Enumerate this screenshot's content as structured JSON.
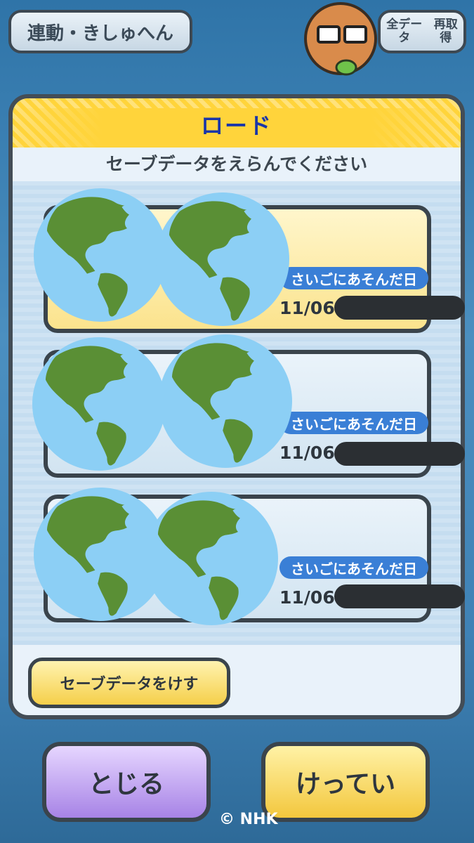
{
  "top": {
    "link_button": "連動・きしゅへん",
    "refetch_line1": "全データ",
    "refetch_line2": "再取得"
  },
  "dialog": {
    "title": "ロード",
    "subtitle": "セーブデータをえらんでください",
    "slots": [
      {
        "label": "さいごにあそんだ日",
        "date": "11/06"
      },
      {
        "label": "さいごにあそんだ日",
        "date": "11/06"
      },
      {
        "label": "さいごにあそんだ日",
        "date": "11/06"
      }
    ],
    "erase_button": "セーブデータをけす"
  },
  "bottom": {
    "close_button": "とじる",
    "confirm_button": "けってい",
    "copyright": "© NHK"
  },
  "colors": {
    "title_blue": "#1a36a8",
    "label_blue": "#3a7fd6",
    "yellow": "#ffd43b",
    "purple": "#a783e6",
    "globe_water": "#8ccff5",
    "globe_land": "#5a8f35"
  },
  "icons": [
    "globe-icon",
    "redaction-bar"
  ]
}
